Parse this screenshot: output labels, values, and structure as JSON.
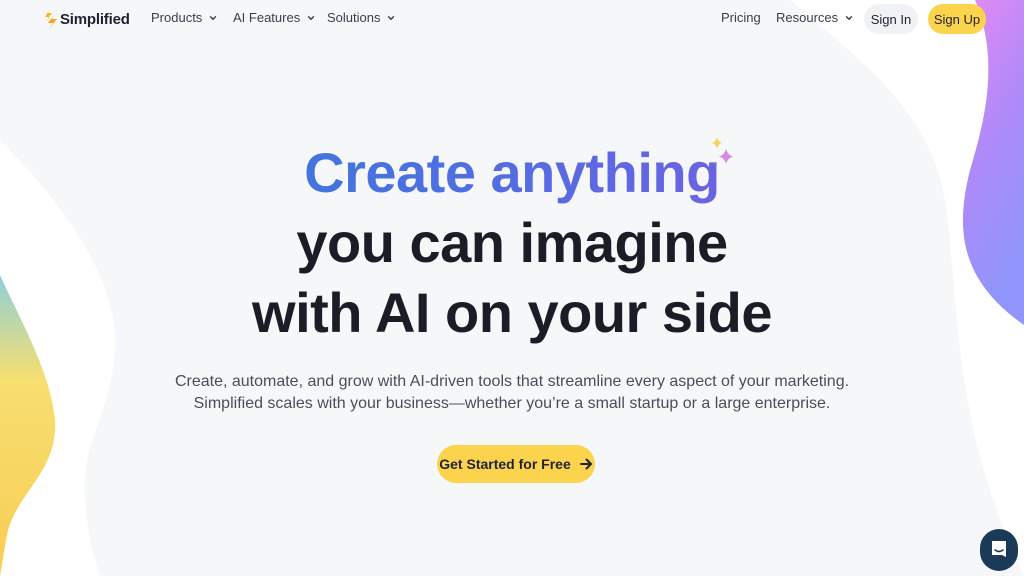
{
  "brand": {
    "name": "Simplified",
    "icon": "lightning-logo-icon"
  },
  "nav": {
    "left_items": [
      {
        "label": "Products",
        "icon": "chevron-down-icon"
      },
      {
        "label": "AI Features",
        "icon": "chevron-down-icon"
      },
      {
        "label": "Solutions",
        "icon": "chevron-down-icon"
      }
    ],
    "right_items": [
      {
        "label": "Pricing"
      },
      {
        "label": "Resources",
        "icon": "chevron-down-icon"
      }
    ],
    "sign_in": "Sign In",
    "sign_up": "Sign Up"
  },
  "hero": {
    "headline_highlight": "Create anything",
    "headline_line2": "you can imagine",
    "headline_line3": "with AI on your side",
    "subtitle_line1": "Create, automate, and grow with AI-driven tools that streamline every aspect of your marketing.",
    "subtitle_line2": "Simplified scales with your business—whether you’re a small startup or a large enterprise.",
    "cta_label": "Get Started for Free",
    "cta_icon": "arrow-right-icon"
  },
  "chat_widget": {
    "icon": "chat-bubble-icon"
  },
  "colors": {
    "accent_yellow": "#fcd34d",
    "gradient_start": "#2b7fd9",
    "gradient_end": "#8a55e6",
    "chat_bg": "#1b3a57"
  }
}
